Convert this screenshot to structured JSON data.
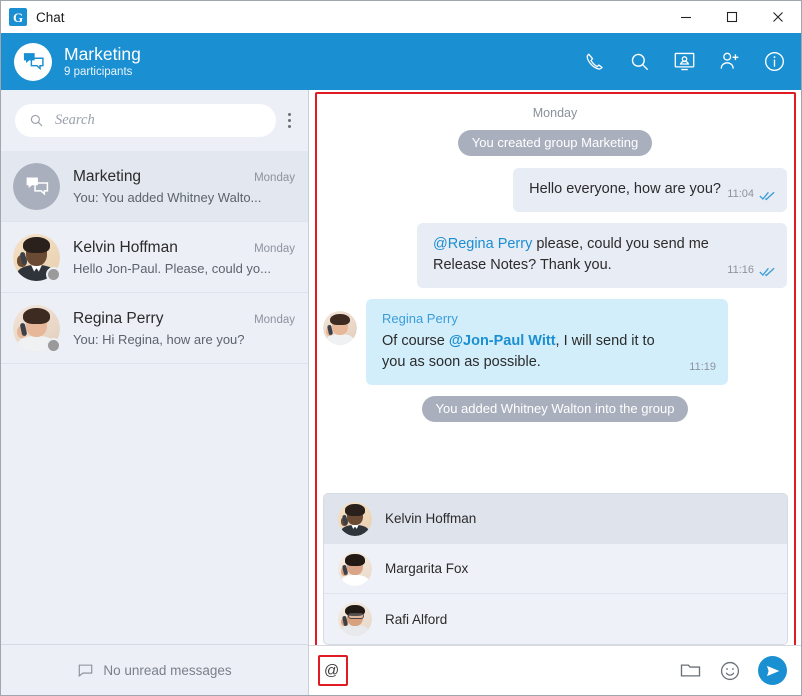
{
  "window": {
    "app_name": "Chat",
    "logo_letter": "G",
    "minimize_label": "Minimize",
    "maximize_label": "Maximize",
    "close_label": "Close"
  },
  "header": {
    "title": "Marketing",
    "subtitle": "9 participants",
    "avatar_icon": "group-chat-icon",
    "accent_color": "#1a8fd1",
    "actions": [
      {
        "name": "call-button",
        "icon": "phone-icon"
      },
      {
        "name": "search-chat-button",
        "icon": "search-icon"
      },
      {
        "name": "video-conference-button",
        "icon": "video-screen-icon"
      },
      {
        "name": "add-participant-button",
        "icon": "add-person-icon"
      },
      {
        "name": "chat-info-button",
        "icon": "info-icon"
      }
    ]
  },
  "sidebar": {
    "search": {
      "placeholder": "Search",
      "value": "",
      "icon": "search-icon"
    },
    "menu_icon": "kebab-menu-icon",
    "conversations": [
      {
        "name": "Marketing",
        "date": "Monday",
        "preview": "You: You added Whitney Walto...",
        "active": true,
        "avatar_type": "group",
        "presence": "none"
      },
      {
        "name": "Kelvin Hoffman",
        "date": "Monday",
        "preview": "Hello Jon-Paul. Please, could yo...",
        "active": false,
        "avatar_type": "man-dark",
        "presence": "offline"
      },
      {
        "name": "Regina Perry",
        "date": "Monday",
        "preview": "You: Hi Regina, how are you?",
        "active": false,
        "avatar_type": "woman-brown",
        "presence": "offline"
      }
    ],
    "footer": {
      "text": "No unread messages",
      "icon": "speech-bubble-icon"
    }
  },
  "chat": {
    "day_separator": "Monday",
    "messages": [
      {
        "kind": "system",
        "text": "You created group Marketing"
      },
      {
        "kind": "outgoing",
        "text": "Hello everyone, how are you?",
        "time": "11:04",
        "status": "read"
      },
      {
        "kind": "outgoing",
        "mention": "@Regina Perry",
        "text": " please, could you send me Release Notes? Thank you.",
        "time": "11:16",
        "status": "read"
      },
      {
        "kind": "incoming",
        "sender": "Regina Perry",
        "text_before": "Of course ",
        "mention": "@Jon-Paul Witt",
        "text_after": ", I will send it to you as soon as possible.",
        "time": "11:19",
        "avatar_type": "woman-brown"
      },
      {
        "kind": "system",
        "text": "You added Whitney Walton into the group"
      }
    ],
    "mention_popup": {
      "highlight_color": "#e01b24",
      "items": [
        {
          "name": "Kelvin Hoffman",
          "avatar_type": "man-dark",
          "selected": true
        },
        {
          "name": "Margarita Fox",
          "avatar_type": "woman-dark",
          "selected": false
        },
        {
          "name": "Rafi Alford",
          "avatar_type": "man-glasses",
          "selected": false
        }
      ]
    },
    "composer": {
      "value": "@",
      "placeholder": "",
      "actions": [
        {
          "name": "attach-file-button",
          "icon": "folder-icon"
        },
        {
          "name": "emoji-button",
          "icon": "smiley-icon"
        },
        {
          "name": "send-button",
          "icon": "send-arrow-icon"
        }
      ]
    }
  }
}
